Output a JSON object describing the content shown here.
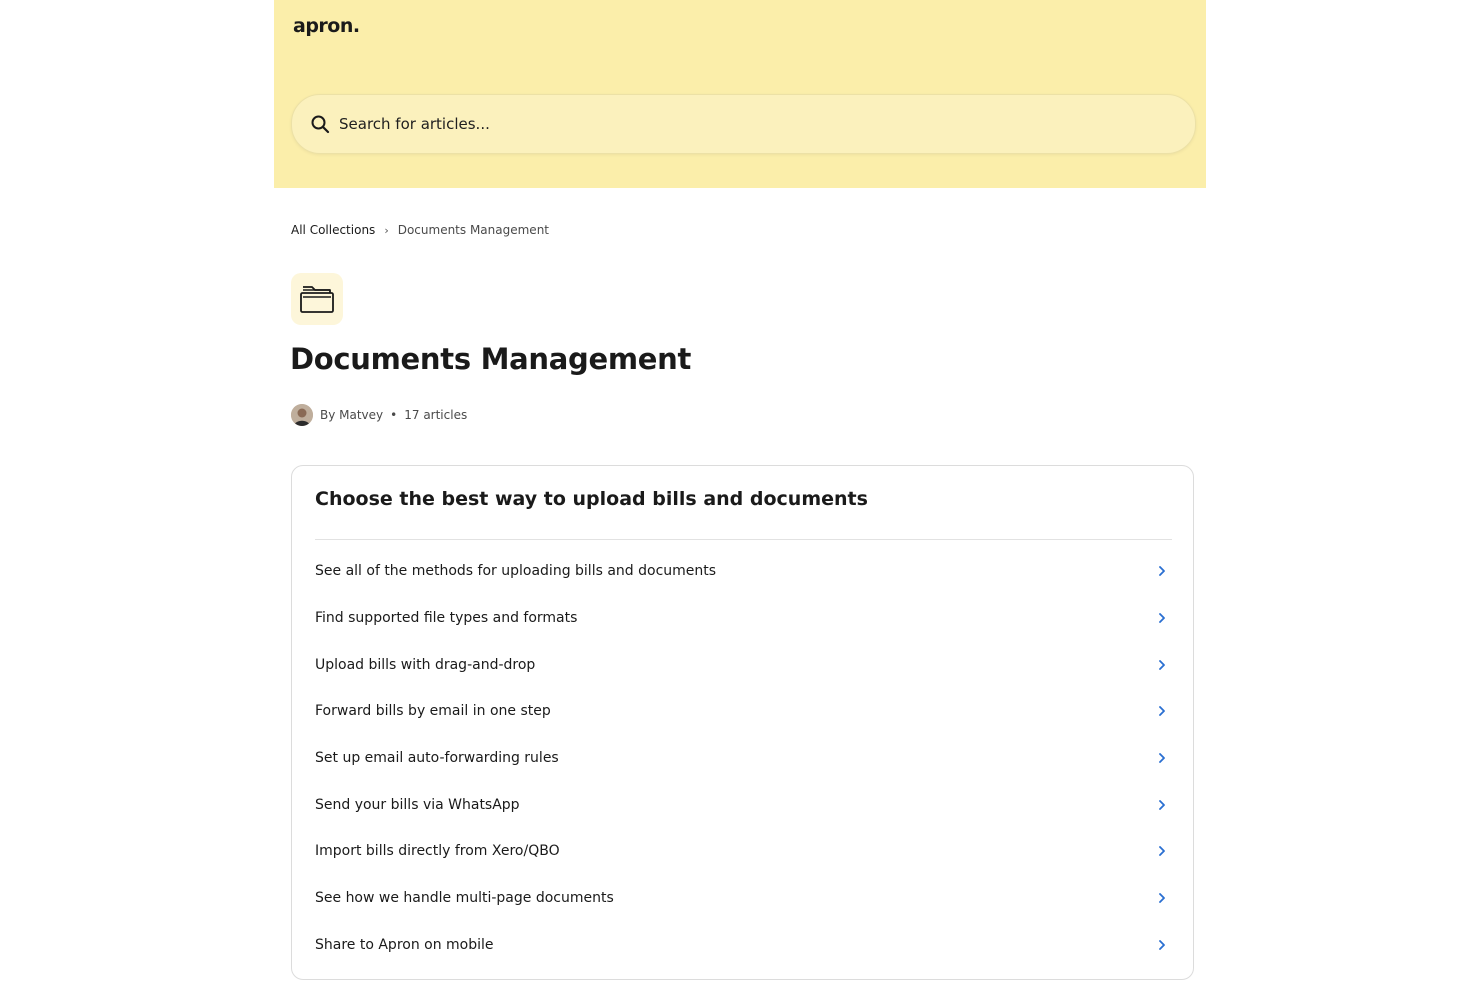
{
  "header": {
    "logo": "apron.",
    "search": {
      "placeholder": "Search for articles..."
    },
    "background": "#fbeeaa"
  },
  "breadcrumb": {
    "root": "All Collections",
    "separator": "›",
    "current": "Documents Management"
  },
  "collection": {
    "icon": "folder-icon",
    "title": "Documents Management",
    "author": "By Matvey",
    "separator": "•",
    "count": "17 articles"
  },
  "section": {
    "title": "Choose the best way to upload bills and documents",
    "accent": "#2a6fd1",
    "articles": [
      {
        "label": "See all of the methods for uploading bills and documents"
      },
      {
        "label": "Find supported file types and formats"
      },
      {
        "label": "Upload bills with drag-and-drop"
      },
      {
        "label": "Forward bills by email in one step"
      },
      {
        "label": "Set up email auto-forwarding rules"
      },
      {
        "label": "Send your bills via WhatsApp"
      },
      {
        "label": "Import bills directly from Xero/QBO"
      },
      {
        "label": "See how we handle multi-page documents"
      },
      {
        "label": "Share to Apron on mobile"
      }
    ]
  }
}
